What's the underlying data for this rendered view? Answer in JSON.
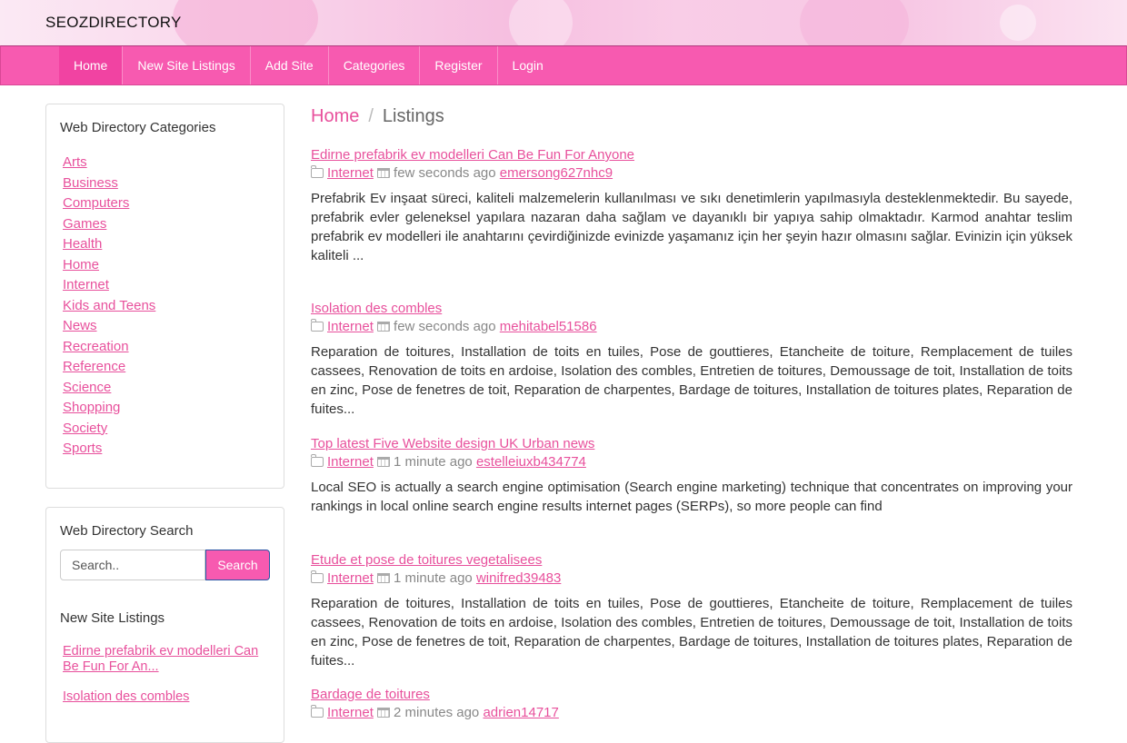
{
  "site": {
    "title": "SEOZDIRECTORY"
  },
  "nav": {
    "items": [
      "Home",
      "New Site Listings",
      "Add Site",
      "Categories",
      "Register",
      "Login"
    ]
  },
  "sidebar": {
    "categories_title": "Web Directory Categories",
    "categories": [
      "Arts",
      "Business",
      "Computers",
      "Games",
      "Health",
      "Home",
      "Internet",
      "Kids and Teens",
      "News",
      "Recreation",
      "Reference",
      "Science",
      "Shopping",
      "Society",
      "Sports"
    ],
    "search_title": "Web Directory Search",
    "search_placeholder": "Search..",
    "search_button": "Search",
    "new_listings_title": "New Site Listings",
    "new_listings": [
      "Edirne prefabrik ev modelleri Can Be Fun For An...",
      "Isolation des combles"
    ]
  },
  "breadcrumb": {
    "home": "Home",
    "sep": "/",
    "current": "Listings"
  },
  "listings": [
    {
      "title": "Edirne prefabrik ev modelleri Can Be Fun For Anyone",
      "category": "Internet",
      "time": "few seconds ago",
      "user": "emersong627nhc9",
      "desc": "Prefabrik Ev inşaat süreci, kaliteli malzemelerin kullanılması ve sıkı denetimlerin yapılmasıyla desteklenmektedir. Bu sayede, prefabrik evler geleneksel yapılara nazaran daha sağlam ve dayanıklı bir yapıya sahip olmaktadır. Karmod anahtar teslim prefabrik ev modelleri ile anahtarını çevirdiğinizde evinizde yaşamanız için her şeyin hazır olmasını sağlar. Evinizin için yüksek kaliteli ..."
    },
    {
      "title": "Isolation des combles",
      "category": "Internet",
      "time": "few seconds ago",
      "user": "mehitabel51586",
      "desc": "Reparation de toitures, Installation de toits en tuiles, Pose de gouttieres, Etancheite de toiture, Remplacement de tuiles cassees, Renovation de toits en ardoise, Isolation des combles, Entretien de toitures, Demoussage de toit, Installation de toits en zinc, Pose de fenetres de toit, Reparation de charpentes, Bardage de toitures, Installation de toitures plates, Reparation de fuites..."
    },
    {
      "title": "Top latest Five Website design UK Urban news",
      "category": "Internet",
      "time": "1 minute ago",
      "user": "estelleiuxb434774",
      "desc": "Local SEO is actually a search engine optimisation (Search engine marketing) technique that concentrates on improving your rankings in local online search engine results internet pages (SERPs), so more people can find"
    },
    {
      "title": "Etude et pose de toitures vegetalisees",
      "category": "Internet",
      "time": "1 minute ago",
      "user": "winifred39483",
      "desc": "Reparation de toitures, Installation de toits en tuiles, Pose de gouttieres, Etancheite de toiture, Remplacement de tuiles cassees, Renovation de toits en ardoise, Isolation des combles, Entretien de toitures, Demoussage de toit, Installation de toits en zinc, Pose de fenetres de toit, Reparation de charpentes, Bardage de toitures, Installation de toitures plates, Reparation de fuites..."
    },
    {
      "title": "Bardage de toitures",
      "category": "Internet",
      "time": "2 minutes ago",
      "user": "adrien14717",
      "desc": ""
    }
  ],
  "colors": {
    "accent": "#f75ab0",
    "link": "#e8509c"
  }
}
